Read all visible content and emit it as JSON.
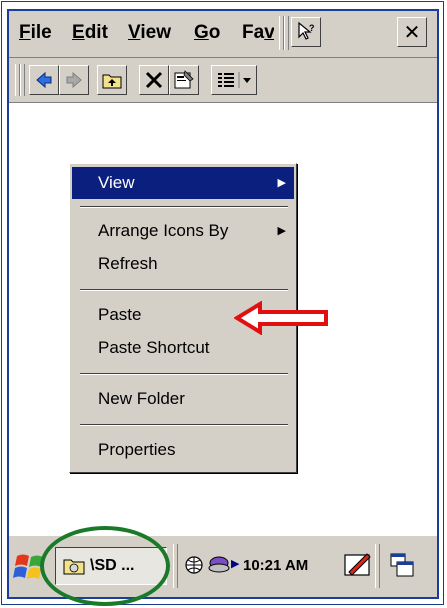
{
  "menubar": {
    "items": [
      {
        "label_u": "F",
        "label_rest": "ile"
      },
      {
        "label_u": "E",
        "label_rest": "dit"
      },
      {
        "label_u": "V",
        "label_rest": "iew"
      },
      {
        "label_u": "G",
        "label_rest": "o"
      },
      {
        "label_pre": "Fa",
        "label_u": "v",
        "label_rest": "orites"
      }
    ],
    "close_glyph": "✕"
  },
  "toolbar": {
    "icons": [
      "back-arrow-icon",
      "forward-arrow-icon",
      "up-folder-icon",
      "delete-icon",
      "properties-icon",
      "view-mode-icon"
    ]
  },
  "context_menu": {
    "items": [
      {
        "label": "View",
        "submenu": true,
        "highlighted": true
      },
      {
        "label": "Arrange Icons By",
        "submenu": true,
        "highlighted": false
      },
      {
        "label": "Refresh",
        "submenu": false,
        "highlighted": false
      },
      {
        "label": "Paste",
        "submenu": false,
        "highlighted": false
      },
      {
        "label": "Paste Shortcut",
        "submenu": false,
        "highlighted": false
      },
      {
        "label": "New Folder",
        "submenu": false,
        "highlighted": false
      },
      {
        "label": "Properties",
        "submenu": false,
        "highlighted": false
      }
    ],
    "submenu_glyph": "▶"
  },
  "taskbar": {
    "task_label": "\\SD ...",
    "clock": "10:21 AM",
    "tray_arrow": "▶"
  },
  "colors": {
    "highlight": "#0b1f7e",
    "annotation_arrow": "#e01010",
    "annotation_circle": "#1a7a2a",
    "chrome": "#d4d0c8"
  }
}
